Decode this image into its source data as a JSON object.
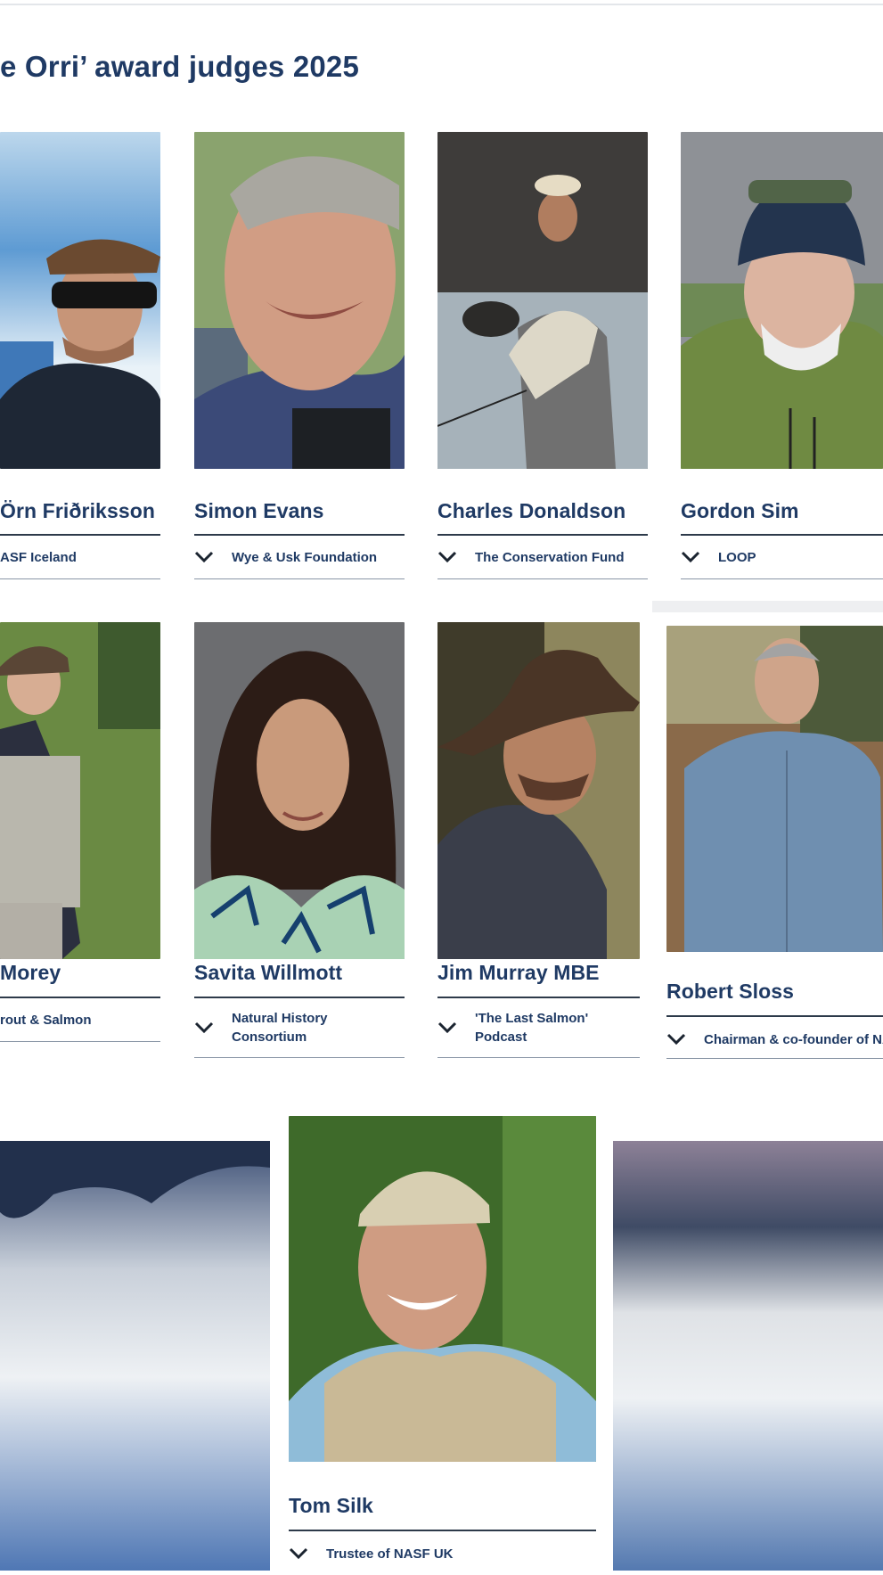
{
  "heading": "e Orri’ award judges 2025",
  "judges": [
    {
      "name": "Örn Friðriksson",
      "role": "ASF Iceland"
    },
    {
      "name": "Simon Evans",
      "role": "Wye & Usk Foundation"
    },
    {
      "name": "Charles Donaldson",
      "role": "The Conservation Fund"
    },
    {
      "name": "Gordon Sim",
      "role": "LOOP"
    },
    {
      "name": "Morey",
      "role": "rout & Salmon"
    },
    {
      "name": "Savita Willmott",
      "role_line1": "Natural History",
      "role_line2": "Consortium"
    },
    {
      "name": "Jim Murray MBE",
      "role_line1": "'The Last Salmon'",
      "role_line2": "Podcast"
    },
    {
      "name": "Robert Sloss",
      "role": "Chairman & co-founder of NA"
    },
    {
      "name": "Tom Silk",
      "role": "Trustee of NASF UK"
    }
  ],
  "icons": {
    "expand": "chevron-down-icon"
  },
  "colors": {
    "heading": "#1f3a64",
    "rule": "#2d3a4a",
    "background": "#ffffff"
  }
}
